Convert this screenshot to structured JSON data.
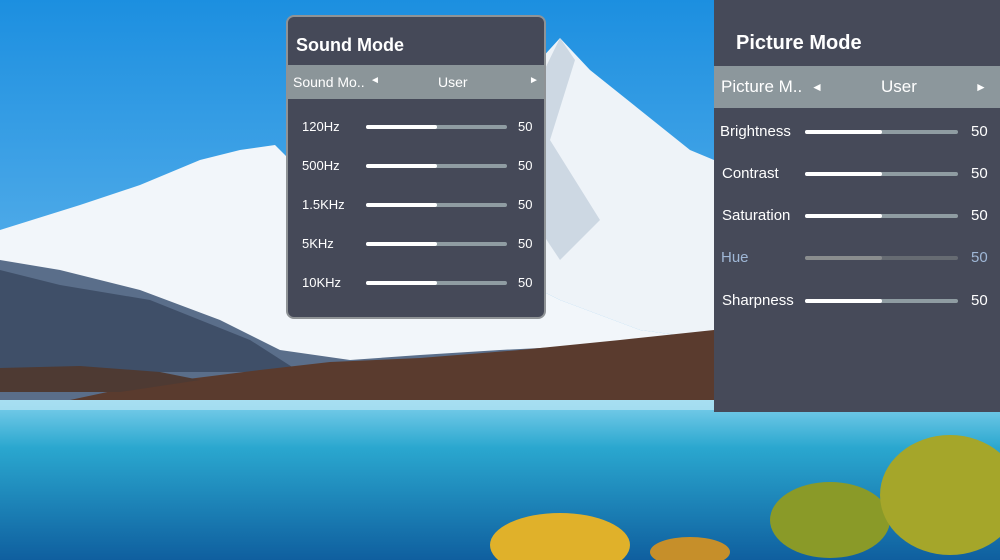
{
  "sound_panel": {
    "title": "Sound Mode",
    "selector_label": "Sound Mo..",
    "selector_value": "User",
    "arrow_left": "◄",
    "arrow_right": "►",
    "bands": [
      {
        "label": "120Hz",
        "value": "50",
        "level": 0.5
      },
      {
        "label": "500Hz",
        "value": "50",
        "level": 0.5
      },
      {
        "label": "1.5KHz",
        "value": "50",
        "level": 0.5
      },
      {
        "label": "5KHz",
        "value": "50",
        "level": 0.5
      },
      {
        "label": "10KHz",
        "value": "50",
        "level": 0.5
      }
    ]
  },
  "picture_panel": {
    "title": "Picture Mode",
    "selector_label": "Picture M..",
    "selector_value": "User",
    "arrow_left": "◄",
    "arrow_right": "►",
    "settings": [
      {
        "label": "Brightness",
        "value": "50",
        "level": 0.5,
        "enabled": true
      },
      {
        "label": "Contrast",
        "value": "50",
        "level": 0.5,
        "enabled": true
      },
      {
        "label": "Saturation",
        "value": "50",
        "level": 0.5,
        "enabled": true
      },
      {
        "label": "Hue",
        "value": "50",
        "level": 0.5,
        "enabled": false
      },
      {
        "label": "Sharpness",
        "value": "50",
        "level": 0.5,
        "enabled": true
      }
    ]
  },
  "colors": {
    "panel_bg": "#454958",
    "selector_bg": "#8b9599",
    "disabled_text": "#9fb7d6"
  }
}
